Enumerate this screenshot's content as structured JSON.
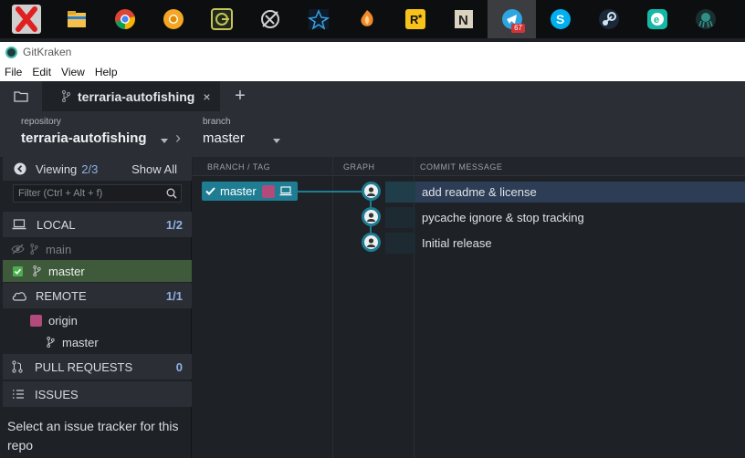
{
  "taskbar": {
    "icons": [
      {
        "name": "close-x-icon",
        "color": "#e02020"
      },
      {
        "name": "file-explorer-icon",
        "color": "#f2c14e"
      },
      {
        "name": "chrome-icon",
        "color": "#4caf50"
      },
      {
        "name": "chrome-canary-icon",
        "color": "#f5a623"
      },
      {
        "name": "app-cc-icon",
        "color": "#c7c35a"
      },
      {
        "name": "app-compass-icon",
        "color": "#cfcfcf"
      },
      {
        "name": "app-star-icon",
        "color": "#3aa0e0"
      },
      {
        "name": "fl-studio-icon",
        "color": "#f08a2a"
      },
      {
        "name": "rockstar-icon",
        "color": "#f7c21a"
      },
      {
        "name": "app-n-icon",
        "color": "#d9d3c0"
      },
      {
        "name": "telegram-icon",
        "color": "#2ca5e0"
      },
      {
        "name": "skype-icon",
        "color": "#00aff0"
      },
      {
        "name": "steam-icon",
        "color": "#1b5f8a"
      },
      {
        "name": "app-e-icon",
        "color": "#14b8a6"
      },
      {
        "name": "gitkraken-icon",
        "color": "#2f8f86"
      }
    ],
    "telegram_badge": "67"
  },
  "window": {
    "title": "GitKraken"
  },
  "menu": [
    "File",
    "Edit",
    "View",
    "Help"
  ],
  "tab": {
    "label": "terraria-autofishing",
    "close": "×",
    "add": "+"
  },
  "repo_header": {
    "repo_caption": "repository",
    "repo_name": "terraria-autofishing",
    "branch_caption": "branch",
    "branch_name": "master"
  },
  "left_panel": {
    "viewing_label": "Viewing",
    "viewing_count": "2/3",
    "show_all": "Show All",
    "filter_placeholder": "Filter (Ctrl + Alt + f)",
    "local": {
      "label": "LOCAL",
      "count": "1/2",
      "branches": [
        "main",
        "master"
      ]
    },
    "remote": {
      "label": "REMOTE",
      "count": "1/1",
      "origin": "origin",
      "branch": "master"
    },
    "pull_requests": {
      "label": "PULL REQUESTS",
      "count": "0"
    },
    "issues": {
      "label": "ISSUES",
      "message": "Select an issue tracker for this repo"
    }
  },
  "graph": {
    "columns": [
      "BRANCH / TAG",
      "GRAPH",
      "COMMIT MESSAGE"
    ],
    "branch_label": "master",
    "commits": [
      {
        "message": "add readme & license",
        "selected": true
      },
      {
        "message": "pycache ignore & stop tracking",
        "selected": false
      },
      {
        "message": "Initial release",
        "selected": false
      }
    ]
  },
  "colors": {
    "accent": "#1e7d93",
    "count": "#8fb0e4",
    "selected_branch": "#3e5a3a",
    "selected_commit": "#2d3d55"
  }
}
